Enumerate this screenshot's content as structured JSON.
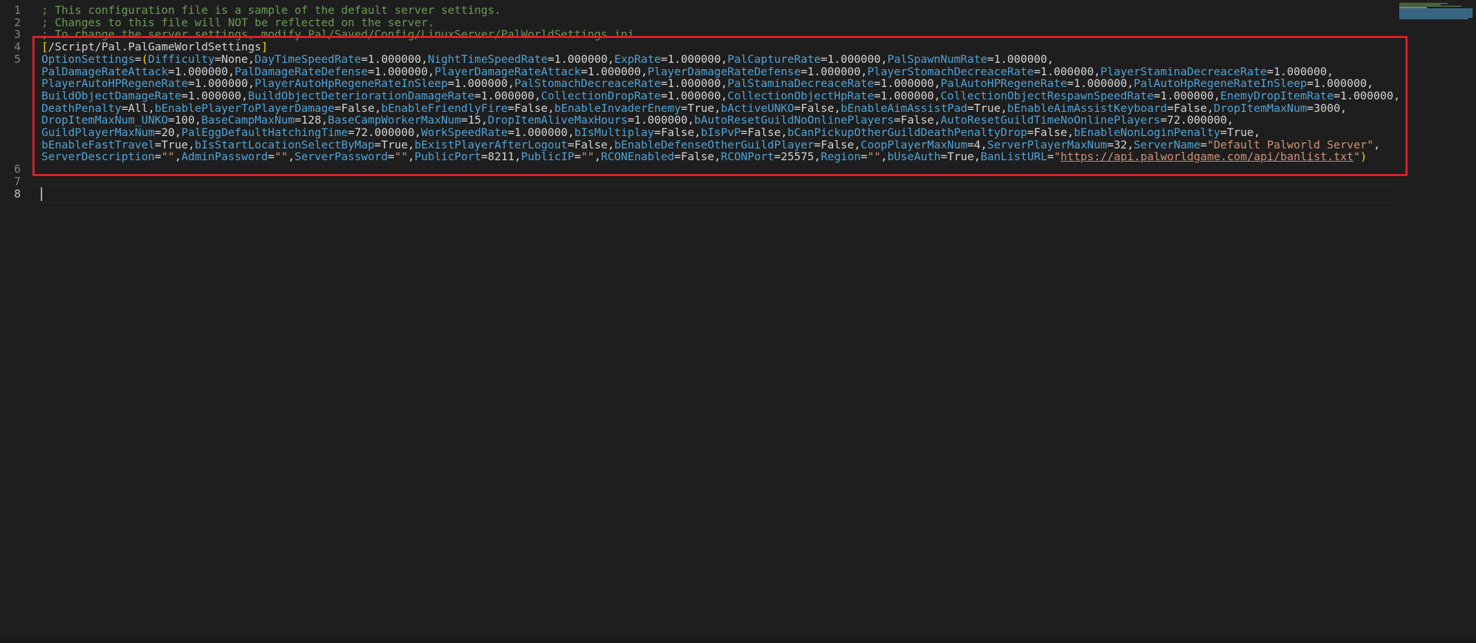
{
  "editor": {
    "line_numbers": [
      "1",
      "2",
      "3",
      "4",
      "5",
      "6",
      "7",
      "8"
    ],
    "comments": [
      "; This configuration file is a sample of the default server settings.",
      "; Changes to this file will NOT be reflected on the server.",
      "; To change the server settings, modify Pal/Saved/Config/LinuxServer/PalWorldSettings.ini."
    ],
    "section_header": "/Script/Pal.PalGameWorldSettings",
    "option_key": "OptionSettings",
    "settings": [
      [
        "Difficulty",
        "None"
      ],
      [
        "DayTimeSpeedRate",
        "1.000000"
      ],
      [
        "NightTimeSpeedRate",
        "1.000000"
      ],
      [
        "ExpRate",
        "1.000000"
      ],
      [
        "PalCaptureRate",
        "1.000000"
      ],
      [
        "PalSpawnNumRate",
        "1.000000"
      ],
      [
        "PalDamageRateAttack",
        "1.000000"
      ],
      [
        "PalDamageRateDefense",
        "1.000000"
      ],
      [
        "PlayerDamageRateAttack",
        "1.000000"
      ],
      [
        "PlayerDamageRateDefense",
        "1.000000"
      ],
      [
        "PlayerStomachDecreaceRate",
        "1.000000"
      ],
      [
        "PlayerStaminaDecreaceRate",
        "1.000000"
      ],
      [
        "PlayerAutoHPRegeneRate",
        "1.000000"
      ],
      [
        "PlayerAutoHpRegeneRateInSleep",
        "1.000000"
      ],
      [
        "PalStomachDecreaceRate",
        "1.000000"
      ],
      [
        "PalStaminaDecreaceRate",
        "1.000000"
      ],
      [
        "PalAutoHPRegeneRate",
        "1.000000"
      ],
      [
        "PalAutoHpRegeneRateInSleep",
        "1.000000"
      ],
      [
        "BuildObjectDamageRate",
        "1.000000"
      ],
      [
        "BuildObjectDeteriorationDamageRate",
        "1.000000"
      ],
      [
        "CollectionDropRate",
        "1.000000"
      ],
      [
        "CollectionObjectHpRate",
        "1.000000"
      ],
      [
        "CollectionObjectRespawnSpeedRate",
        "1.000000"
      ],
      [
        "EnemyDropItemRate",
        "1.000000"
      ],
      [
        "DeathPenalty",
        "All"
      ],
      [
        "bEnablePlayerToPlayerDamage",
        "False"
      ],
      [
        "bEnableFriendlyFire",
        "False"
      ],
      [
        "bEnableInvaderEnemy",
        "True"
      ],
      [
        "bActiveUNKO",
        "False"
      ],
      [
        "bEnableAimAssistPad",
        "True"
      ],
      [
        "bEnableAimAssistKeyboard",
        "False"
      ],
      [
        "DropItemMaxNum",
        "3000"
      ],
      [
        "DropItemMaxNum_UNKO",
        "100"
      ],
      [
        "BaseCampMaxNum",
        "128"
      ],
      [
        "BaseCampWorkerMaxNum",
        "15"
      ],
      [
        "DropItemAliveMaxHours",
        "1.000000"
      ],
      [
        "bAutoResetGuildNoOnlinePlayers",
        "False"
      ],
      [
        "AutoResetGuildTimeNoOnlinePlayers",
        "72.000000"
      ],
      [
        "GuildPlayerMaxNum",
        "20"
      ],
      [
        "PalEggDefaultHatchingTime",
        "72.000000"
      ],
      [
        "WorkSpeedRate",
        "1.000000"
      ],
      [
        "bIsMultiplay",
        "False"
      ],
      [
        "bIsPvP",
        "False"
      ],
      [
        "bCanPickupOtherGuildDeathPenaltyDrop",
        "False"
      ],
      [
        "bEnableNonLoginPenalty",
        "True"
      ],
      [
        "bEnableFastTravel",
        "True"
      ],
      [
        "bIsStartLocationSelectByMap",
        "True"
      ],
      [
        "bExistPlayerAfterLogout",
        "False"
      ],
      [
        "bEnableDefenseOtherGuildPlayer",
        "False"
      ],
      [
        "CoopPlayerMaxNum",
        "4"
      ],
      [
        "ServerPlayerMaxNum",
        "32"
      ],
      [
        "ServerName",
        "\"Default Palworld Server\""
      ],
      [
        "ServerDescription",
        "\"\""
      ],
      [
        "AdminPassword",
        "\"\""
      ],
      [
        "ServerPassword",
        "\"\""
      ],
      [
        "PublicPort",
        "8211"
      ],
      [
        "PublicIP",
        "\"\""
      ],
      [
        "RCONEnabled",
        "False"
      ],
      [
        "RCONPort",
        "25575"
      ],
      [
        "Region",
        "\"\""
      ],
      [
        "bUseAuth",
        "True"
      ],
      [
        "BanListURL",
        "\"https://api.palworldgame.com/api/banlist.txt\""
      ]
    ],
    "wrap_after_indices": [
      6,
      12,
      18,
      24,
      32,
      38,
      45,
      52
    ],
    "active_line": "8"
  },
  "colors": {
    "background": "#1e1e1e",
    "comment": "#6a9955",
    "key": "#4fa3d6",
    "string": "#ce9178",
    "bracket": "#ffd700",
    "highlight_box": "#e0202a"
  }
}
